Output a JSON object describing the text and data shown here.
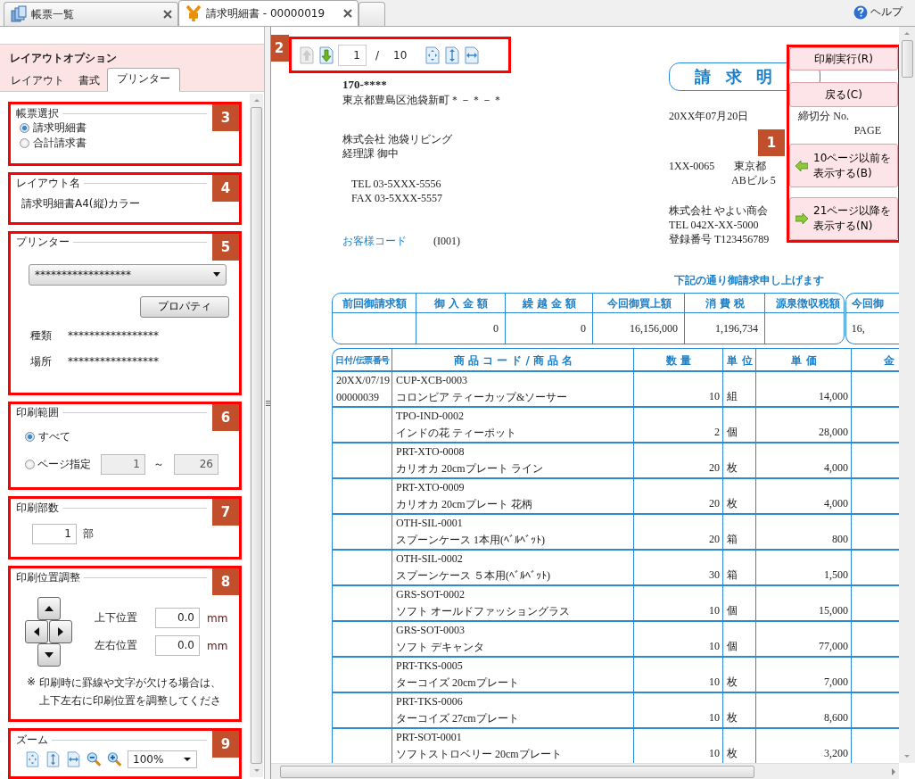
{
  "tabs": [
    {
      "label": "帳票一覧",
      "selected": false
    },
    {
      "label": "請求明細書 - 00000019",
      "selected": true
    }
  ],
  "help": "ヘルプ",
  "options_panel": {
    "title": "レイアウトオプション",
    "tabs": [
      {
        "label": "レイアウト",
        "selected": false
      },
      {
        "label": "書式",
        "selected": false
      },
      {
        "label": "プリンター",
        "selected": true
      }
    ]
  },
  "sections": [
    {
      "kind": "radios",
      "callout": "3",
      "legend": "帳票選択",
      "options": [
        {
          "label": "請求明細書",
          "selected": true
        },
        {
          "label": "合計請求書",
          "selected": false
        }
      ]
    },
    {
      "kind": "text",
      "callout": "4",
      "legend": "レイアウト名",
      "value": "請求明細書A4(縦)カラー"
    },
    {
      "kind": "printer",
      "callout": "5",
      "legend": "プリンター",
      "printer": "******************",
      "button": "プロパティ",
      "fields": [
        {
          "label": "種類",
          "value": "*****************"
        },
        {
          "label": "場所",
          "value": "*****************"
        }
      ]
    },
    {
      "kind": "range",
      "callout": "6",
      "legend": "印刷範囲",
      "options": [
        {
          "label": "すべて",
          "selected": true
        },
        {
          "label": "ページ指定",
          "selected": false
        }
      ],
      "from": "1",
      "separator": "～",
      "to": "26"
    },
    {
      "kind": "copies",
      "callout": "7",
      "legend": "印刷部数",
      "value": "1",
      "unit": "部"
    },
    {
      "kind": "position",
      "callout": "8",
      "legend": "印刷位置調整",
      "fields": [
        {
          "label": "上下位置",
          "value": "0.0",
          "unit": "mm"
        },
        {
          "label": "左右位置",
          "value": "0.0",
          "unit": "mm"
        }
      ],
      "note_mark": "※",
      "note": [
        "印刷時に罫線や文字が欠ける場合は、",
        "上下左右に印刷位置を調整してくださ"
      ]
    },
    {
      "kind": "zoom",
      "callout": "9",
      "legend": "ズーム",
      "value": "100%"
    }
  ],
  "toolbar": {
    "callout": "2",
    "page": "1",
    "separator": "/",
    "total": "10"
  },
  "actions": {
    "callout": "1",
    "buttons": [
      {
        "kind": "plain",
        "lines": [
          "印刷実行(R)"
        ]
      },
      {
        "kind": "plain",
        "lines": [
          "戻る(C)"
        ]
      },
      {
        "kind": "prev",
        "lines": [
          "10ページ以前を",
          "表示する(B)"
        ]
      },
      {
        "kind": "next",
        "lines": [
          "21ページ以降を",
          "表示する(N)"
        ]
      }
    ]
  },
  "document": {
    "title": "請 求 明",
    "recipient": {
      "postal": "170-****",
      "address": "東京都豊島区池袋新町＊－＊－＊",
      "company": "株式会社  池袋リビング",
      "department": "経理課 御中",
      "tel": "TEL 03-5XXX-5556",
      "fax": "FAX 03-5XXX-5557",
      "code_label": "お客様コード",
      "code": "(I001)"
    },
    "issuer": {
      "date": "20XX年07月20日",
      "closing": "締切分 No.",
      "page": "PAGE",
      "postal": "1XX-0065",
      "address": "東京都",
      "building": "ABビル 5",
      "company": "株式会社 やよい商会",
      "tel": "TEL 042X-XX-5000",
      "registration": "登録番号 T123456789"
    },
    "message": "下記の通り御請求申し上げます",
    "summary": {
      "columns": [
        {
          "label": "前回御請求額"
        },
        {
          "label": "御 入 金 額",
          "value": "0"
        },
        {
          "label": "繰 越 金 額",
          "value": "0"
        },
        {
          "label": "今回御買上額",
          "value": "16,156,000"
        },
        {
          "label": "消 費 税",
          "value": "1,196,734"
        },
        {
          "label": "源泉徴収税額"
        }
      ],
      "next_column": "今回御",
      "next_value": "16,"
    },
    "items": {
      "columns": [
        "日付/伝票番号",
        "商 品 コ ー ド / 商 品 名",
        "数 量",
        "単 位",
        "単 価",
        "金"
      ],
      "rows": [
        {
          "date": "20XX/07/19",
          "slip": "00000039",
          "code": "CUP-XCB-0003",
          "name": "コロンビア ティーカップ&ソーサー",
          "quantity": "10",
          "unit": "組",
          "price": "14,000"
        },
        {
          "code": "TPO-IND-0002",
          "name": "インドの花 ティーポット",
          "quantity": "2",
          "unit": "個",
          "price": "28,000"
        },
        {
          "code": "PRT-XTO-0008",
          "name": "カリオカ 20cmプレート ライン",
          "quantity": "20",
          "unit": "枚",
          "price": "4,000"
        },
        {
          "code": "PRT-XTO-0009",
          "name": "カリオカ 20cmプレート 花柄",
          "quantity": "20",
          "unit": "枚",
          "price": "4,000"
        },
        {
          "code": "OTH-SIL-0001",
          "name": "スプーンケース 1本用(ﾍﾞﾙﾍﾞｯﾄ)",
          "quantity": "20",
          "unit": "箱",
          "price": "800"
        },
        {
          "code": "OTH-SIL-0002",
          "name": "スプーンケース ５本用(ﾍﾞﾙﾍﾞｯﾄ)",
          "quantity": "30",
          "unit": "箱",
          "price": "1,500"
        },
        {
          "code": "GRS-SOT-0002",
          "name": "ソフト オールドファッショングラス",
          "quantity": "10",
          "unit": "個",
          "price": "15,000"
        },
        {
          "code": "GRS-SOT-0003",
          "name": "ソフト デキャンタ",
          "quantity": "10",
          "unit": "個",
          "price": "77,000"
        },
        {
          "code": "PRT-TKS-0005",
          "name": "ターコイズ 20cmプレート",
          "quantity": "10",
          "unit": "枚",
          "price": "7,000"
        },
        {
          "code": "PRT-TKS-0006",
          "name": "ターコイズ 27cmプレート",
          "quantity": "10",
          "unit": "枚",
          "price": "8,600"
        },
        {
          "code": "PRT-SOT-0001",
          "name": "ソフトストロベリー 20cmプレート",
          "quantity": "10",
          "unit": "枚",
          "price": "3,200"
        }
      ]
    }
  }
}
